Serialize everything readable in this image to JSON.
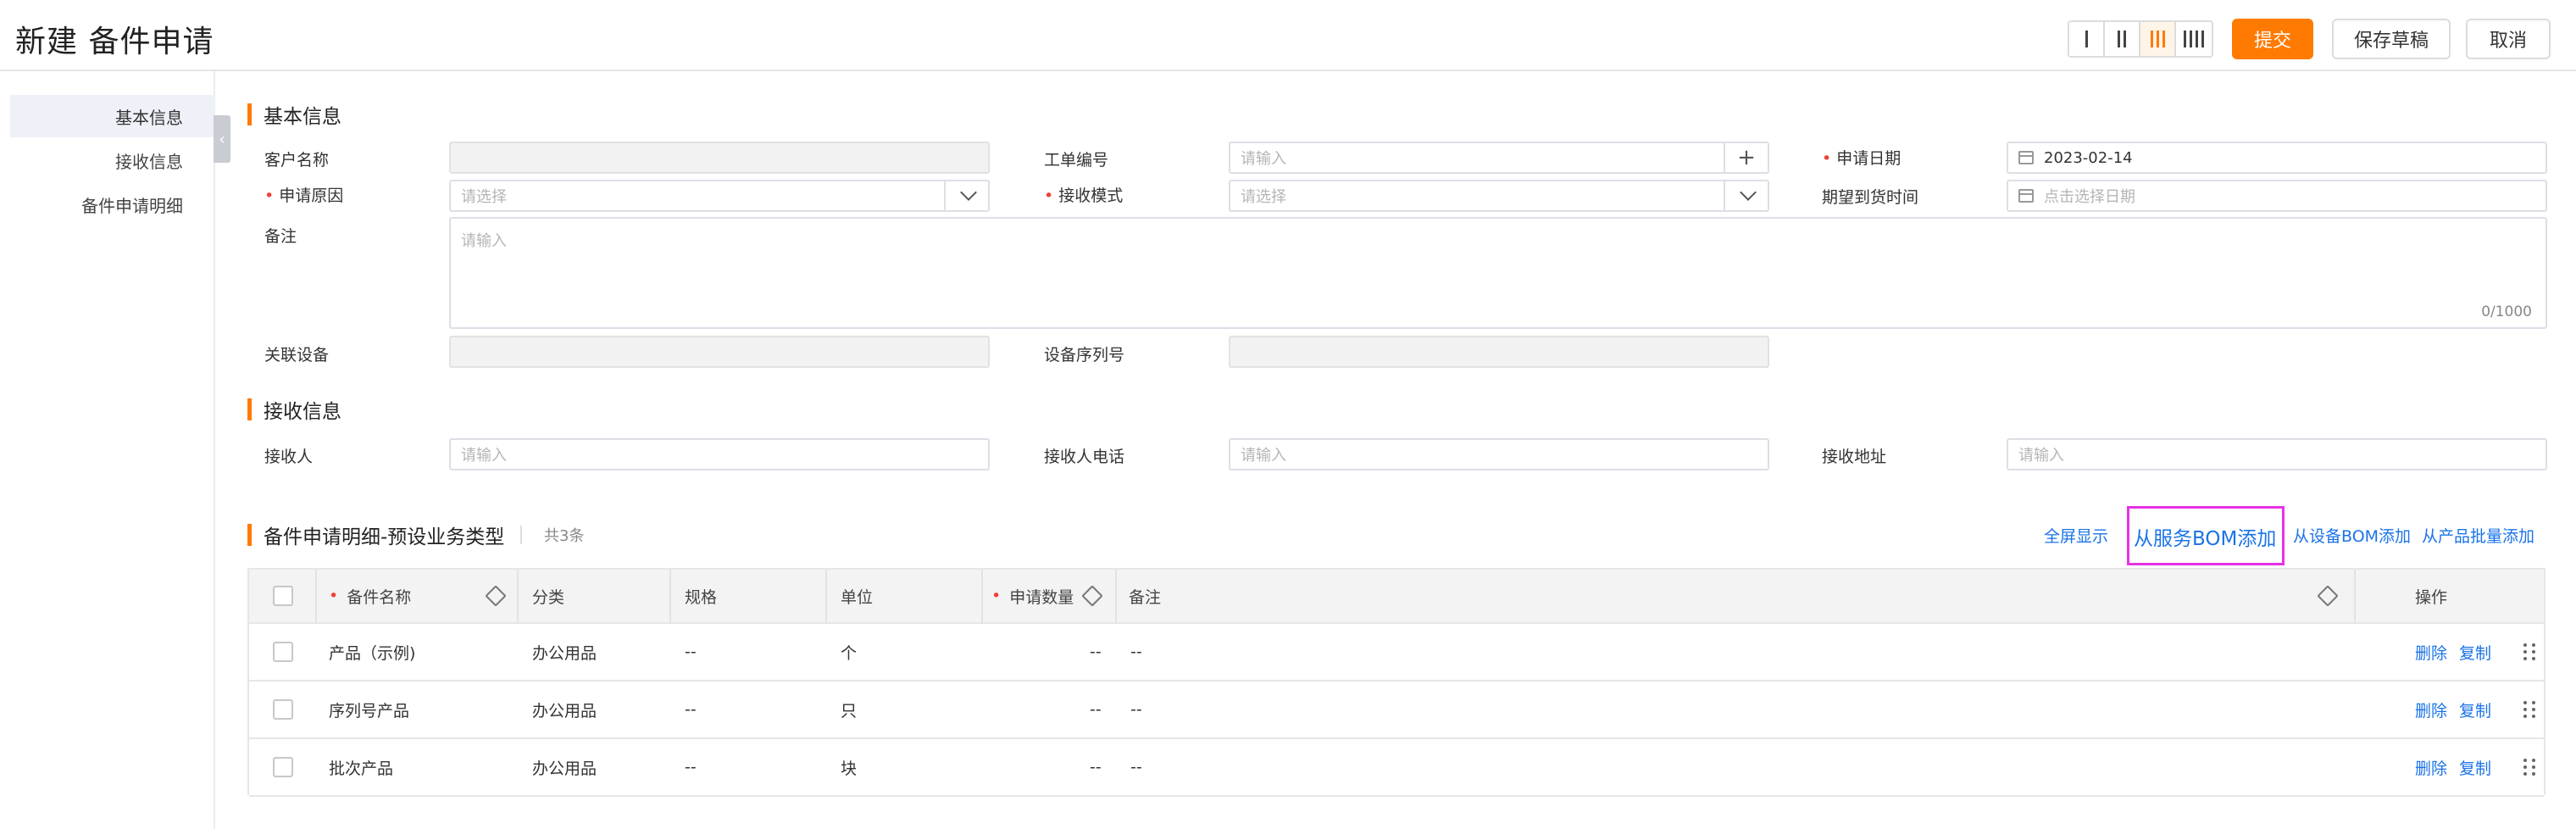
{
  "header": {
    "title": "新建 备件申请",
    "submit_label": "提交",
    "save_draft_label": "保存草稿",
    "cancel_label": "取消"
  },
  "sidenav": {
    "items": [
      {
        "label": "基本信息",
        "active": true
      },
      {
        "label": "接收信息",
        "active": false
      },
      {
        "label": "备件申请明细",
        "active": false
      }
    ]
  },
  "basic_info": {
    "title": "基本信息",
    "customer_name_label": "客户名称",
    "work_order_label": "工单编号",
    "work_order_placeholder": "请输入",
    "apply_date_label": "申请日期",
    "apply_date_value": "2023-02-14",
    "reason_label": "申请原因",
    "reason_placeholder": "请选择",
    "receive_mode_label": "接收模式",
    "receive_mode_placeholder": "请选择",
    "expected_arrival_label": "期望到货时间",
    "expected_arrival_placeholder": "点击选择日期",
    "remark_label": "备注",
    "remark_placeholder": "请输入",
    "remark_counter": "0/1000",
    "related_device_label": "关联设备",
    "device_serial_label": "设备序列号"
  },
  "receive_info": {
    "title": "接收信息",
    "receiver_label": "接收人",
    "receiver_placeholder": "请输入",
    "receiver_phone_label": "接收人电话",
    "receiver_phone_placeholder": "请输入",
    "receive_address_label": "接收地址",
    "receive_address_placeholder": "请输入"
  },
  "detail": {
    "title": "备件申请明细-预设业务类型",
    "count_text": "共3条",
    "fullscreen_label": "全屏显示",
    "add_from_service_bom": "从服务BOM添加",
    "add_from_device_bom": "从设备BOM添加",
    "add_from_product_batch": "从产品批量添加",
    "columns": {
      "name": "备件名称",
      "category": "分类",
      "spec": "规格",
      "unit": "单位",
      "qty": "申请数量",
      "remark": "备注",
      "ops": "操作"
    },
    "rows": [
      {
        "name": "产品（示例)",
        "category": "办公用品",
        "spec": "--",
        "unit": "个",
        "qty": "--",
        "remark": "--",
        "delete": "删除",
        "copy": "复制"
      },
      {
        "name": "序列号产品",
        "category": "办公用品",
        "spec": "--",
        "unit": "只",
        "qty": "--",
        "remark": "--",
        "delete": "删除",
        "copy": "复制"
      },
      {
        "name": "批次产品",
        "category": "办公用品",
        "spec": "--",
        "unit": "块",
        "qty": "--",
        "remark": "--",
        "delete": "删除",
        "copy": "复制"
      }
    ]
  },
  "colors": {
    "accent": "#ff7a00",
    "link": "#1a73e8",
    "required": "#f04134",
    "highlight_box": "#e632e6"
  }
}
